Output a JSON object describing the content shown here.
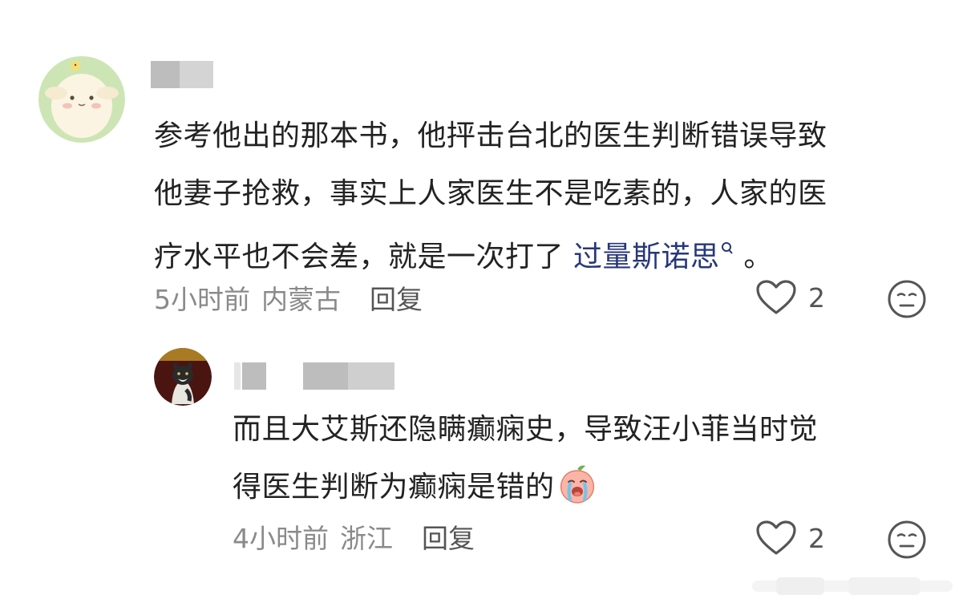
{
  "comments": [
    {
      "text_lines": [
        "参考他出的那本书，他抨击台北的医生判断错误导致",
        "他妻子抢救，事实上人家医生不是吃素的，人家的医",
        "疗水平也不会差，就是一次打了 "
      ],
      "link_text": "过量斯诺思",
      "tail_text": " 。",
      "time": "5小时前",
      "location": "内蒙古",
      "reply_label": "回复",
      "like_count": "2",
      "avatar_icon": "sheep-avatar"
    },
    {
      "text_lines": [
        "而且大艾斯还隐瞒癫痫史，导致汪小菲当时觉",
        "得医生判断为癫痫是错的"
      ],
      "emoji": "crying-peach-emoji",
      "time": "4小时前",
      "location": "浙江",
      "reply_label": "回复",
      "like_count": "2",
      "avatar_icon": "cat-avatar"
    }
  ],
  "colors": {
    "text": "#222222",
    "link": "#27377a",
    "meta": "#8a8a8a",
    "icon": "#555555"
  }
}
